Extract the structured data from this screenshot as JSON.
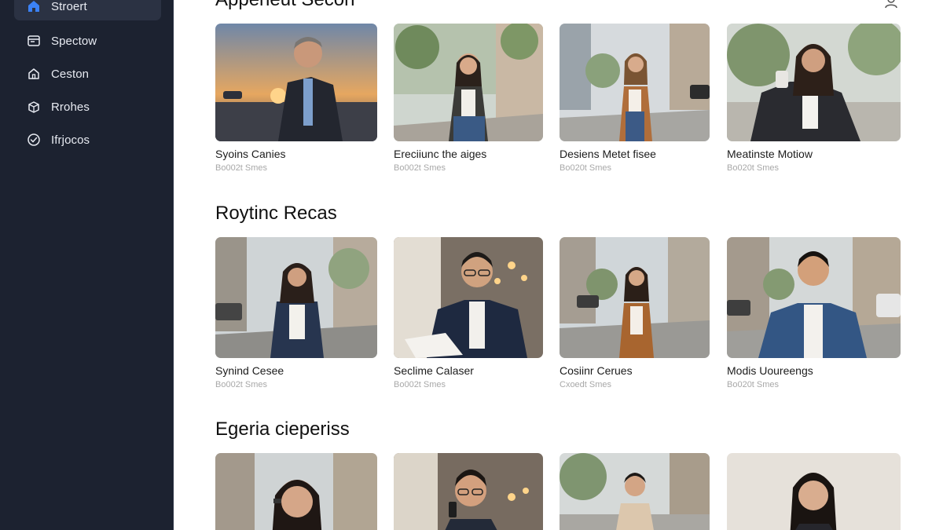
{
  "sidebar": {
    "items": [
      {
        "label": "Stroert",
        "icon": "home-icon",
        "active": true
      },
      {
        "label": "Spectow",
        "icon": "browser-window-icon",
        "active": false
      },
      {
        "label": "Ceston",
        "icon": "house-outline-icon",
        "active": false
      },
      {
        "label": "Rrohes",
        "icon": "box-icon",
        "active": false
      },
      {
        "label": "Ifrjocos",
        "icon": "shield-check-icon",
        "active": false
      }
    ],
    "accent": "#3b82f6"
  },
  "header": {
    "title": "Appeneut Secon",
    "profile_icon": "user-icon"
  },
  "sections": [
    {
      "title": "Roytinc Recas",
      "cards": [
        {
          "title": "Synind Cesee",
          "meta": "Bo002t Smes"
        },
        {
          "title": "Seclime Calaser",
          "meta": "Bo002t Smes"
        },
        {
          "title": "Cosiinr Cerues",
          "meta": "Cxoedt Smes"
        },
        {
          "title": "Modis Uoureengs",
          "meta": "Bo020t Smes"
        }
      ]
    },
    {
      "title": "Egeria cieperiss",
      "cards": [
        {
          "title": "",
          "meta": ""
        },
        {
          "title": "",
          "meta": ""
        },
        {
          "title": "",
          "meta": ""
        },
        {
          "title": "",
          "meta": ""
        }
      ]
    }
  ],
  "top_cards": [
    {
      "title": "Syoins Canies",
      "meta": "Bo002t Smes"
    },
    {
      "title": "Ereciiunc the aiges",
      "meta": "Bo002t Smes"
    },
    {
      "title": "Desiens Metet fisee",
      "meta": "Bo020t Smes"
    },
    {
      "title": "Meatinste Motiow",
      "meta": "Bo020t Smes"
    }
  ]
}
